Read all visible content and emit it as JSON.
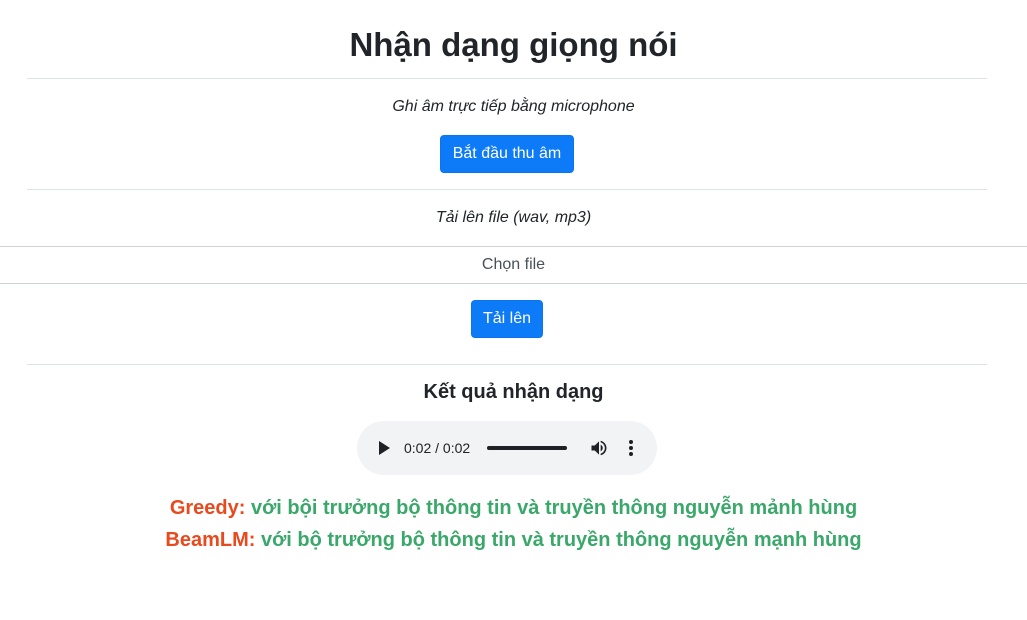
{
  "page_title": "Nhận dạng giọng nói",
  "record": {
    "label": "Ghi âm trực tiếp bằng microphone",
    "button": "Bắt đầu thu âm"
  },
  "upload": {
    "label": "Tải lên file (wav, mp3)",
    "chooser": "Chọn file",
    "button": "Tải lên"
  },
  "results": {
    "heading": "Kết quả nhận dạng",
    "audio": {
      "time": "0:02 / 0:02",
      "progress": 1.0,
      "play_icon": "play-icon",
      "volume_icon": "volume-icon",
      "more_icon": "more-vert-icon"
    },
    "lines": [
      {
        "label": "Greedy:",
        "text": "với bội trưởng bộ thông tin và truyền thông nguyễn mảnh hùng"
      },
      {
        "label": "BeamLM:",
        "text": "với bộ trưởng bộ thông tin và truyền thông nguyễn mạnh hùng"
      }
    ]
  },
  "colors": {
    "primary_button": "#0d7bf7",
    "result_label": "#e8491d",
    "result_text": "#3aa86a",
    "audio_bg": "#f1f3f4"
  }
}
